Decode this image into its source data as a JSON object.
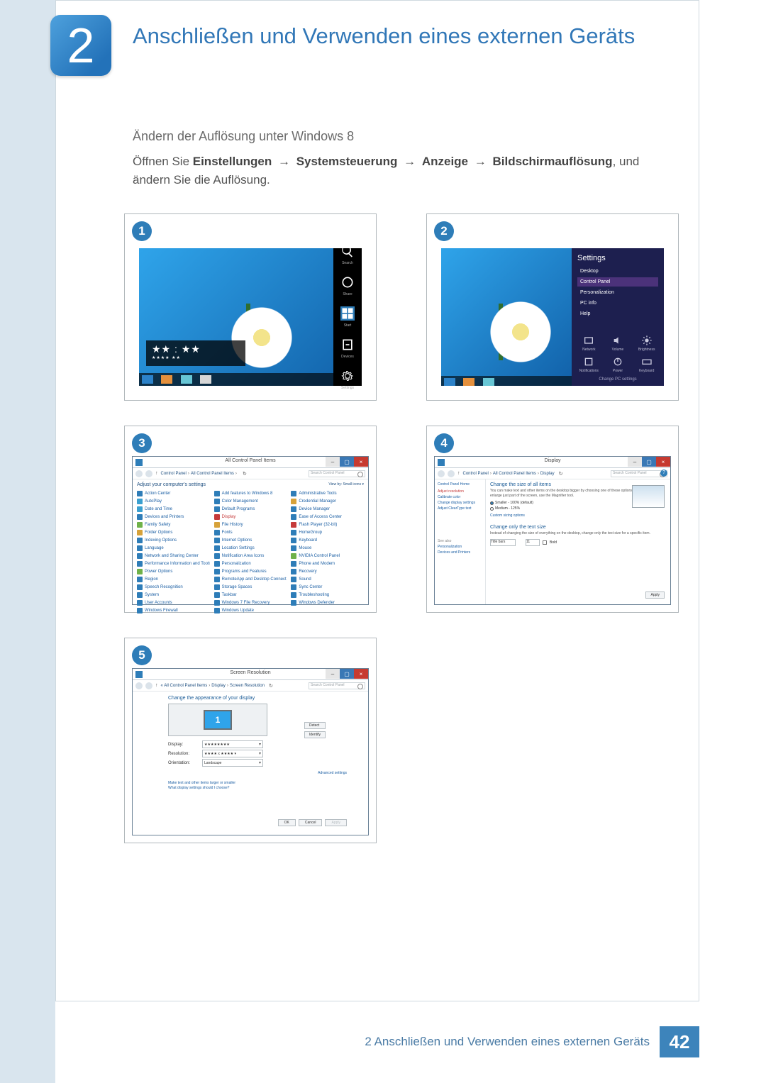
{
  "chapter": {
    "number": "2",
    "title": "Anschließen und Verwenden eines externen Geräts"
  },
  "section": {
    "subtitle": "Ändern der Auflösung unter Windows 8",
    "instruction_pre": "Öffnen Sie ",
    "path": [
      "Einstellungen",
      "Systemsteuerung",
      "Anzeige",
      "Bildschirmauflösung"
    ],
    "instruction_post": ", und ändern Sie die Auflösung."
  },
  "arrow": "→",
  "steps": {
    "1": {
      "charms": [
        "Search",
        "Share",
        "Start",
        "Devices",
        "Settings"
      ],
      "timecard": {
        "time": "★★ : ★★",
        "date": "★★★★ ★★"
      }
    },
    "2": {
      "settings_title": "Settings",
      "items": [
        "Desktop",
        "Control Panel",
        "Personalization",
        "PC info",
        "Help"
      ],
      "hi_item": "Control Panel",
      "tiles": [
        "Network",
        "Volume",
        "Brightness",
        "Notifications",
        "Power",
        "Keyboard"
      ],
      "change_settings": "Change PC settings"
    },
    "3": {
      "window_title": "All Control Panel Items",
      "breadcrumb": [
        "Control Panel",
        "All Control Panel Items"
      ],
      "search_placeholder": "Search Control Panel",
      "adjust": "Adjust your computer's settings",
      "viewby": "View by:   Small icons ▾",
      "items": [
        {
          "t": "Action Center",
          "c": "#2e7db8"
        },
        {
          "t": "Add features to Windows 8",
          "c": "#2e7db8"
        },
        {
          "t": "Administrative Tools",
          "c": "#2e7db8"
        },
        {
          "t": "AutoPlay",
          "c": "#3aa0d0"
        },
        {
          "t": "Color Management",
          "c": "#2e7db8"
        },
        {
          "t": "Credential Manager",
          "c": "#d6a23a"
        },
        {
          "t": "Date and Time",
          "c": "#3aa0d0"
        },
        {
          "t": "Default Programs",
          "c": "#2e7db8"
        },
        {
          "t": "Device Manager",
          "c": "#2e7db8"
        },
        {
          "t": "Devices and Printers",
          "c": "#2e7db8"
        },
        {
          "t": "Display",
          "c": "#c53a3a",
          "hi": true
        },
        {
          "t": "Ease of Access Center",
          "c": "#2e7db8"
        },
        {
          "t": "Family Safety",
          "c": "#6fb24a"
        },
        {
          "t": "File History",
          "c": "#d6a23a"
        },
        {
          "t": "Flash Player (32-bit)",
          "c": "#c53a3a"
        },
        {
          "t": "Folder Options",
          "c": "#d6a23a"
        },
        {
          "t": "Fonts",
          "c": "#2e7db8"
        },
        {
          "t": "HomeGroup",
          "c": "#2e7db8"
        },
        {
          "t": "Indexing Options",
          "c": "#2e7db8"
        },
        {
          "t": "Internet Options",
          "c": "#2e7db8"
        },
        {
          "t": "Keyboard",
          "c": "#2e7db8"
        },
        {
          "t": "Language",
          "c": "#2e7db8"
        },
        {
          "t": "Location Settings",
          "c": "#2e7db8"
        },
        {
          "t": "Mouse",
          "c": "#2e7db8"
        },
        {
          "t": "Network and Sharing Center",
          "c": "#2e7db8"
        },
        {
          "t": "Notification Area Icons",
          "c": "#2e7db8"
        },
        {
          "t": "NVIDIA Control Panel",
          "c": "#6fb24a"
        },
        {
          "t": "Performance Information and Tools",
          "c": "#2e7db8"
        },
        {
          "t": "Personalization",
          "c": "#2e7db8"
        },
        {
          "t": "Phone and Modem",
          "c": "#2e7db8"
        },
        {
          "t": "Power Options",
          "c": "#6fb24a"
        },
        {
          "t": "Programs and Features",
          "c": "#2e7db8"
        },
        {
          "t": "Recovery",
          "c": "#2e7db8"
        },
        {
          "t": "Region",
          "c": "#2e7db8"
        },
        {
          "t": "RemoteApp and Desktop Connections",
          "c": "#2e7db8"
        },
        {
          "t": "Sound",
          "c": "#2e7db8"
        },
        {
          "t": "Speech Recognition",
          "c": "#2e7db8"
        },
        {
          "t": "Storage Spaces",
          "c": "#2e7db8"
        },
        {
          "t": "Sync Center",
          "c": "#2e7db8"
        },
        {
          "t": "System",
          "c": "#2e7db8"
        },
        {
          "t": "Taskbar",
          "c": "#2e7db8"
        },
        {
          "t": "Troubleshooting",
          "c": "#2e7db8"
        },
        {
          "t": "User Accounts",
          "c": "#2e7db8"
        },
        {
          "t": "Windows 7 File Recovery",
          "c": "#2e7db8"
        },
        {
          "t": "Windows Defender",
          "c": "#2e7db8"
        },
        {
          "t": "Windows Firewall",
          "c": "#2e7db8"
        },
        {
          "t": "Windows Update",
          "c": "#2e7db8"
        }
      ]
    },
    "4": {
      "window_title": "Display",
      "breadcrumb": [
        "Control Panel",
        "All Control Panel Items",
        "Display"
      ],
      "search_placeholder": "Search Control Panel",
      "side": {
        "home": "Control Panel Home",
        "links": [
          {
            "t": "Adjust resolution",
            "hi": true
          },
          {
            "t": "Calibrate color"
          },
          {
            "t": "Change display settings"
          },
          {
            "t": "Adjust ClearType text"
          }
        ],
        "seealso_title": "See also",
        "seealso_links": [
          "Personalization",
          "Devices and Printers"
        ]
      },
      "main": {
        "h1": "Change the size of all items",
        "p1": "You can make text and other items on the desktop bigger by choosing one of these options. To temporarily enlarge just part of the screen, use the Magnifier tool.",
        "opt1": "Smaller - 100% (default)",
        "opt2": "Medium - 125%",
        "custom_link": "Custom sizing options",
        "h2": "Change only the text size",
        "p2": "Instead of changing the size of everything on the desktop, change only the text size for a specific item.",
        "row_label": "Title bars",
        "row_size": "11",
        "row_bold": "Bold",
        "apply": "Apply"
      }
    },
    "5": {
      "window_title": "Screen Resolution",
      "breadcrumb": [
        "All Control Panel Items",
        "Display",
        "Screen Resolution"
      ],
      "search_placeholder": "Search Control Panel",
      "heading": "Change the appearance of your display",
      "monitor_num": "1",
      "detect": "Detect",
      "identify": "Identify",
      "rows": {
        "display_lbl": "Display:",
        "display_val": "★★★★★★★★",
        "res_lbl": "Resolution:",
        "res_val": "★★★★ x ★★★★ ▾",
        "orient_lbl": "Orientation:",
        "orient_val": "Landscape"
      },
      "adv": "Advanced settings",
      "links": [
        "Make text and other items larger or smaller",
        "What display settings should I choose?"
      ],
      "ok": "OK",
      "cancel": "Cancel",
      "apply": "Apply"
    }
  },
  "footer": {
    "text": "2 Anschließen und Verwenden eines externen Geräts",
    "page": "42"
  }
}
